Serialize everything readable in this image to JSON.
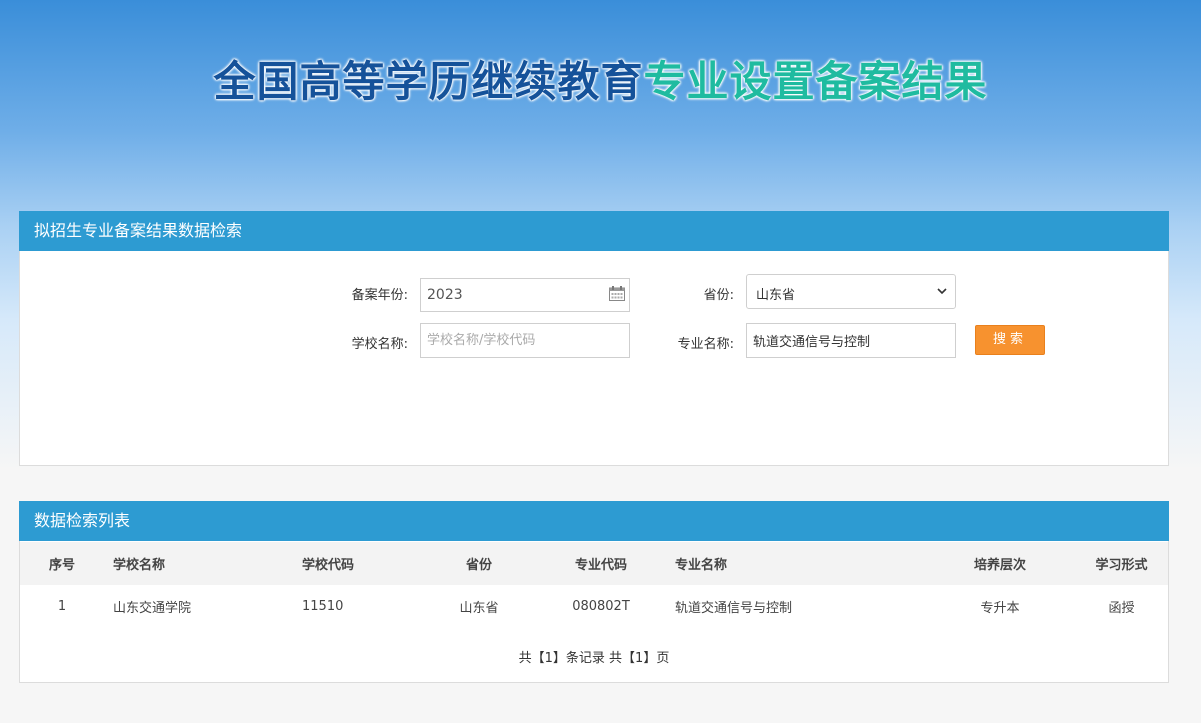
{
  "banner": {
    "title_part1": "全国高等学历继续教育",
    "title_part2": "专业设置备案结果"
  },
  "search_panel": {
    "header": "拟招生专业备案结果数据检索",
    "year_label": "备案年份:",
    "year_value": "2023",
    "province_label": "省份:",
    "province_value": "山东省",
    "school_label": "学校名称:",
    "school_placeholder": "学校名称/学校代码",
    "school_value": "",
    "major_label": "专业名称:",
    "major_value": "轨道交通信号与控制",
    "search_button": "搜索"
  },
  "result_panel": {
    "header": "数据检索列表",
    "columns": [
      "序号",
      "学校名称",
      "学校代码",
      "省份",
      "专业代码",
      "专业名称",
      "培养层次",
      "学习形式"
    ],
    "rows": [
      [
        "1",
        "山东交通学院",
        "11510",
        "山东省",
        "080802T",
        "轨道交通信号与控制",
        "专升本",
        "函授"
      ]
    ],
    "pagination": "共【1】条记录 共【1】页"
  },
  "icons": {
    "date": "calendar-icon",
    "select": "chevron-down-icon"
  },
  "colors": {
    "panel_header": "#2d9bd2",
    "search_button": "#f7922f",
    "title_blue": "#15529a",
    "title_green": "#1fbba0"
  }
}
